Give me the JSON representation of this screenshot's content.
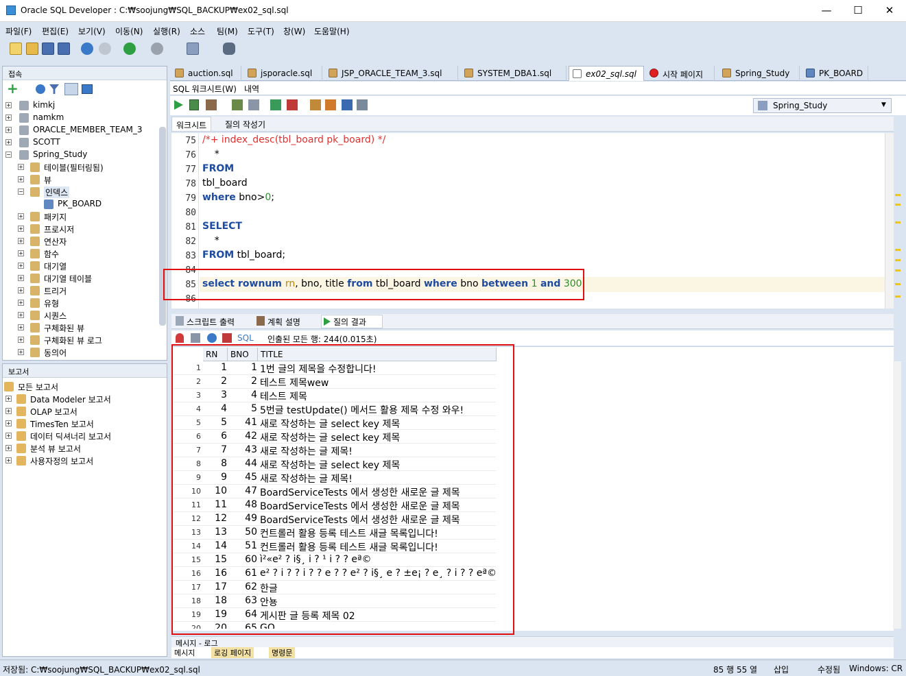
{
  "window": {
    "title": "Oracle SQL Developer : C:₩soojung₩SQL_BACKUP₩ex02_sql.sql",
    "minimize": "—",
    "maximize": "☐",
    "close": "✕"
  },
  "menu": [
    "파일(F)",
    "편집(E)",
    "보기(V)",
    "이동(N)",
    "실행(R)",
    "소스",
    "팀(M)",
    "도구(T)",
    "창(W)",
    "도움말(H)"
  ],
  "connections": {
    "title": "접속",
    "items": [
      "kimkj",
      "namkm",
      "ORACLE_MEMBER_TEAM_3",
      "SCOTT",
      "Spring_Study"
    ],
    "children": [
      "테이블(필터링됨)",
      "뷰",
      "인덱스",
      "PK_BOARD",
      "패키지",
      "프로시저",
      "연산자",
      "함수",
      "대기열",
      "대기열 테이블",
      "트리거",
      "유형",
      "시퀀스",
      "구체화된 뷰",
      "구체화된 뷰 로그",
      "동의어"
    ]
  },
  "reports": {
    "title": "보고서",
    "items": [
      "모든 보고서",
      "Data Modeler 보고서",
      "OLAP 보고서",
      "TimesTen 보고서",
      "데이터 딕셔너리 보고서",
      "분석 뷰 보고서",
      "사용자정의 보고서"
    ]
  },
  "tabs": [
    "auction.sql",
    "jsporacle.sql",
    "JSP_ORACLE_TEAM_3.sql",
    "SYSTEM_DBA1.sql",
    "ex02_sql.sql",
    "시작 페이지",
    "Spring_Study",
    "PK_BOARD"
  ],
  "worksheet": {
    "subtabs": [
      "SQL 워크시트(W)",
      "내역"
    ],
    "connection": "Spring_Study",
    "innertabs": [
      "워크시트",
      "질의 작성기"
    ]
  },
  "code": {
    "line_numbers": [
      "75",
      "76",
      "77",
      "78",
      "79",
      "80",
      "81",
      "82",
      "83",
      "84",
      "85",
      "86"
    ],
    "l75": "/*+ index_desc(tbl_board pk_board) */",
    "l76": "    *",
    "l77": "FROM",
    "l78": "tbl_board",
    "l79a": "where",
    "l79b": " bno>",
    "l79c": "0",
    "l79d": ";",
    "l81": "SELECT",
    "l82": "    *",
    "l83a": "FROM",
    "l83b": " tbl_board;",
    "l85": {
      "a": "select",
      "b": " rownum ",
      "c": "rn",
      "d": ", bno, title ",
      "e": "from",
      "f": " tbl_board ",
      "g": "where",
      "h": " bno ",
      "i": "between",
      "j": "1",
      "k": "and",
      "l": "300",
      "m": ";"
    }
  },
  "results": {
    "tabs": [
      "스크립트 출력",
      "계획 설명",
      "질의 결과"
    ],
    "sql_label": "SQL",
    "fetch_info": "인출된 모든 행: 244(0.015초)",
    "columns": [
      "RN",
      "BNO",
      "TITLE"
    ],
    "rows": [
      [
        "1",
        "1",
        "1",
        "1번 글의 제목을 수정합니다!"
      ],
      [
        "2",
        "2",
        "2",
        "테스트 제목wew"
      ],
      [
        "3",
        "3",
        "4",
        "테스트 제목"
      ],
      [
        "4",
        "4",
        "5",
        "5번글 testUpdate() 메서드 활용 제목 수정 와우!"
      ],
      [
        "5",
        "5",
        "41",
        "새로 작성하는 글 select key 제목"
      ],
      [
        "6",
        "6",
        "42",
        "새로 작성하는 글 select key 제목"
      ],
      [
        "7",
        "7",
        "43",
        "새로 작성하는 글 제목!"
      ],
      [
        "8",
        "8",
        "44",
        "새로 작성하는 글 select key 제목"
      ],
      [
        "9",
        "9",
        "45",
        "새로 작성하는 글 제목!"
      ],
      [
        "10",
        "10",
        "47",
        "BoardServiceTests 에서 생성한 새로운 글 제목"
      ],
      [
        "11",
        "11",
        "48",
        "BoardServiceTests 에서 생성한 새로운 글 제목"
      ],
      [
        "12",
        "12",
        "49",
        "BoardServiceTests 에서 생성한 새로운 글 제목"
      ],
      [
        "13",
        "13",
        "50",
        "컨트롤러 활용 등록 테스트 새글 목록입니다!"
      ],
      [
        "14",
        "14",
        "51",
        "컨트롤러 활용 등록 테스트 새글 목록입니다!"
      ],
      [
        "15",
        "15",
        "60",
        "ì²«e² ? i§¸ i ? ¹ i ?  ? eª©"
      ],
      [
        "16",
        "16",
        "61",
        "e² ? i ?  ? i ?  ?  e ?  ? e² ? i§¸ e ? ±e¡ ? e¸ ?  i ?  ? eª©"
      ],
      [
        "17",
        "17",
        "62",
        "한글"
      ],
      [
        "18",
        "18",
        "63",
        "안뇽"
      ],
      [
        "19",
        "19",
        "64",
        "게시판 글 등록 제목 02"
      ],
      [
        "20",
        "20",
        "65",
        "GO"
      ]
    ]
  },
  "bottom": {
    "log_title": "메시지 - 로그",
    "tabs": [
      "메시지",
      "로깅 페이지",
      "명령문"
    ]
  },
  "status": {
    "path": "저장됨: C:₩soojung₩SQL_BACKUP₩ex02_sql.sql",
    "pos": "85 행 55 열",
    "mode": "삽입",
    "mod": "수정됨",
    "os": "Windows: CR"
  },
  "colors": {
    "accent": "#1e4ba0",
    "highlight": "#e01010",
    "comment": "#e03030",
    "number": "#2c8c2c"
  }
}
